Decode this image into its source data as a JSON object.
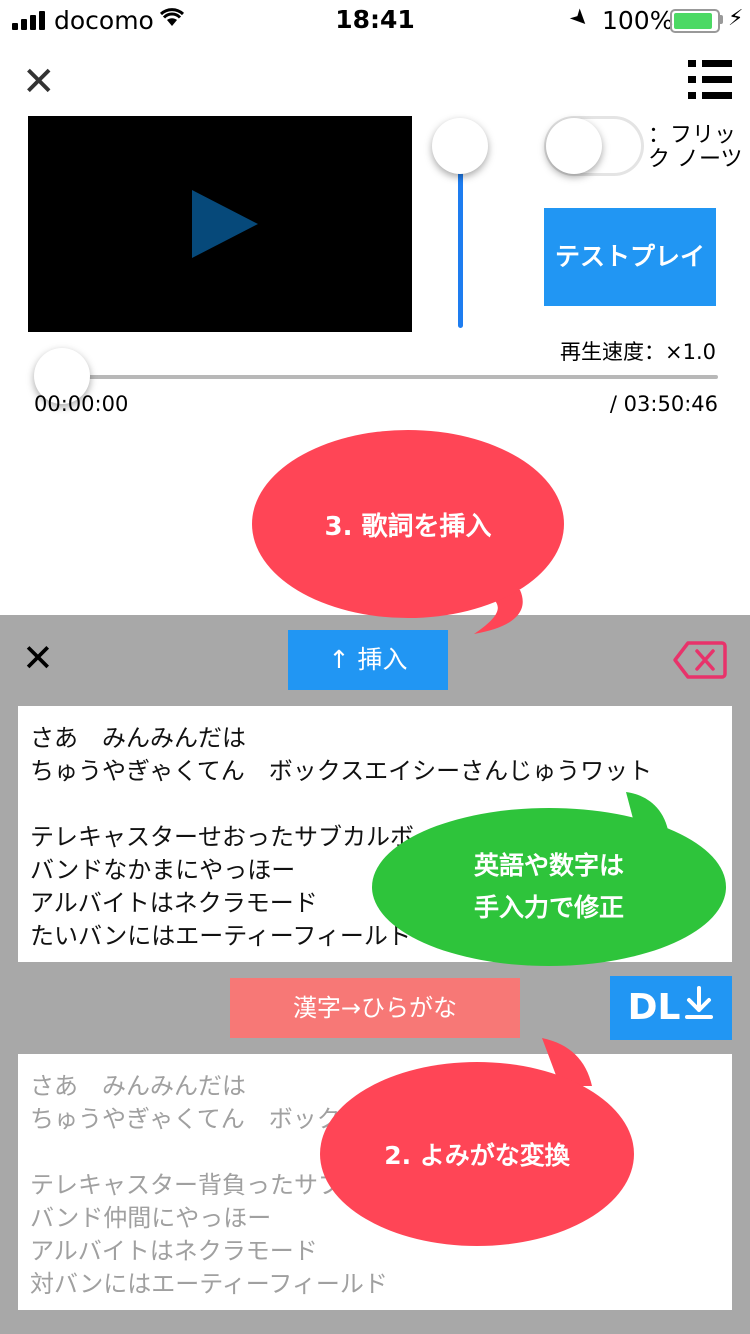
{
  "status_bar": {
    "carrier": "docomo",
    "time": "18:41",
    "battery": "100%",
    "battery_level": 1.0
  },
  "player": {
    "test_play_label": "テストプレイ",
    "flick_label": "：フリック ノーツ",
    "speed_label": "再生速度：×1.0",
    "time_current": "00:00:00",
    "time_total": "/ 03:50:46",
    "progress": 0,
    "flick_enabled": false
  },
  "annotations": {
    "step3": "3. 歌詞を挿入",
    "note": "英語や数字は\n手入力で修正",
    "step2": "2. よみがな変換"
  },
  "panel": {
    "insert_label": "↑ 挿入",
    "kana_label": "漢字→ひらがな",
    "dl_label": "DL",
    "lyrics_input": "さあ　みんみんだは\nちゅうやぎゃくてん　ボックスエイシーさんじゅうワット\n\nテレキャスターせおったサブカルボーイが\nバンドなかまにやっほー\nアルバイトはネクラモード\nたいバンにはエーティーフィールド",
    "lyrics_source": "さあ　みんみんだは\nちゅうやぎゃくてん　ボックスエイシー30ワット\n\nテレキャスター背負ったサブカルボーイが\nバンド仲間にやっほー\nアルバイトはネクラモード\n対バンにはエーティーフィールド"
  }
}
